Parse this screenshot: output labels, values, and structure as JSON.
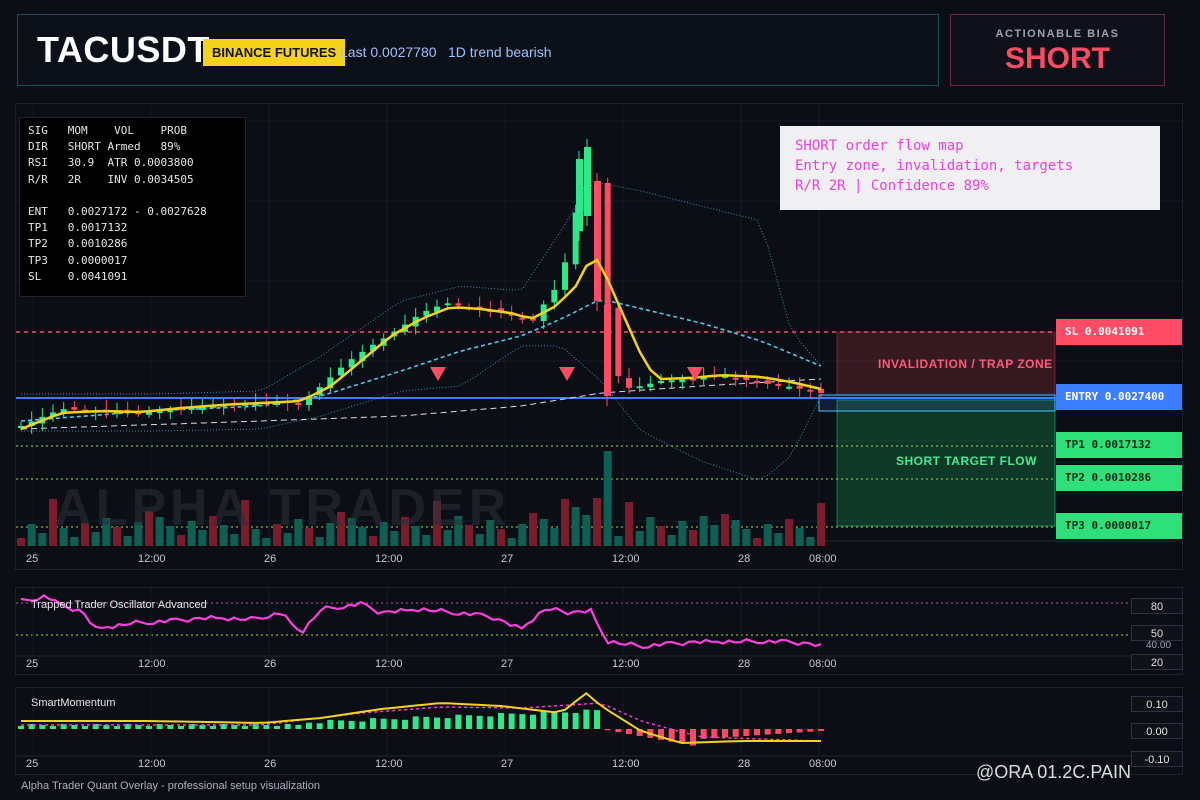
{
  "header": {
    "symbol": "TACUSDT",
    "exchange_badge": "BINANCE FUTURES",
    "last_price": "Last 0.0027780",
    "trend": "1D trend bearish"
  },
  "bias": {
    "label": "ACTIONABLE BIAS",
    "value": "SHORT"
  },
  "stats_table": {
    "rows": [
      "SIG   MOM    VOL    PROB",
      "DIR   SHORT Armed   89%",
      "RSI   30.9  ATR 0.0003800",
      "R/R   2R    INV 0.0034505",
      "",
      "ENT   0.0027172 - 0.0027628",
      "TP1   0.0017132",
      "TP2   0.0010286",
      "TP3   0.0000017",
      "SL    0.0041091"
    ]
  },
  "note": {
    "lines": [
      "SHORT order flow map",
      "Entry zone, invalidation, targets",
      "R/R 2R | Confidence 89%"
    ]
  },
  "levels": {
    "sl": "SL 0.0041091",
    "entry": "ENTRY 0.0027400",
    "tp1": "TP1 0.0017132",
    "tp2": "TP2 0.0010286",
    "tp3": "TP3 0.0000017"
  },
  "zones": {
    "invalidation": "INVALIDATION / TRAP ZONE",
    "target": "SHORT TARGET FLOW"
  },
  "colors": {
    "up": "#26a69a",
    "up_candle": "#2ee88a",
    "down": "#ff4b64",
    "ema": "#f5d31a",
    "entry": "#3d7dff",
    "sl": "#ff4b64",
    "tp": "#26e07a",
    "oscillator": "#ff3fe0"
  },
  "x_axis_labels": [
    "25",
    "12:00",
    "26",
    "12:00",
    "27",
    "12:00",
    "28",
    "08:00"
  ],
  "watermark": "ALPHA TRADER",
  "oscillator": {
    "title": "Trapped Trader Oscillator Advanced",
    "levels": [
      "80",
      "50",
      "40.00",
      "20"
    ]
  },
  "momentum": {
    "title": "SmartMomentum",
    "levels": [
      "0.10",
      "0.00",
      "-0.10"
    ]
  },
  "footer": "Alpha Trader Quant Overlay - professional setup visualization",
  "source_watermark": "@ORA 01.2C.PAIN",
  "chart_data": {
    "type": "candlestick",
    "symbol": "TACUSDT",
    "x_ticks": [
      "25",
      "12:00",
      "26",
      "12:00",
      "27",
      "12:00",
      "28",
      "08:00"
    ],
    "close_path": [
      0.0027,
      0.00272,
      0.00275,
      0.00273,
      0.00272,
      0.00274,
      0.00276,
      0.00275,
      0.00277,
      0.00279,
      0.00285,
      0.003,
      0.00318,
      0.00335,
      0.0035,
      0.00362,
      0.00355,
      0.00352,
      0.00358,
      0.0035,
      0.00365,
      0.00395,
      0.0044,
      0.0052,
      0.0054,
      0.00345,
      0.00285,
      0.0029,
      0.00292,
      0.00295,
      0.00288,
      0.00285,
      0.00278
    ],
    "horizontal_levels": {
      "SL": 0.0041091,
      "ENTRY": 0.00274,
      "TP1": 0.0017132,
      "TP2": 0.0010286,
      "TP3": 1.7e-06
    },
    "entry_zone": [
      0.0027172,
      0.0027628
    ],
    "oscillator_levels": [
      80,
      50,
      40,
      20
    ],
    "oscillator_last": 40,
    "momentum_levels": [
      0.1,
      0.0,
      -0.1
    ]
  }
}
